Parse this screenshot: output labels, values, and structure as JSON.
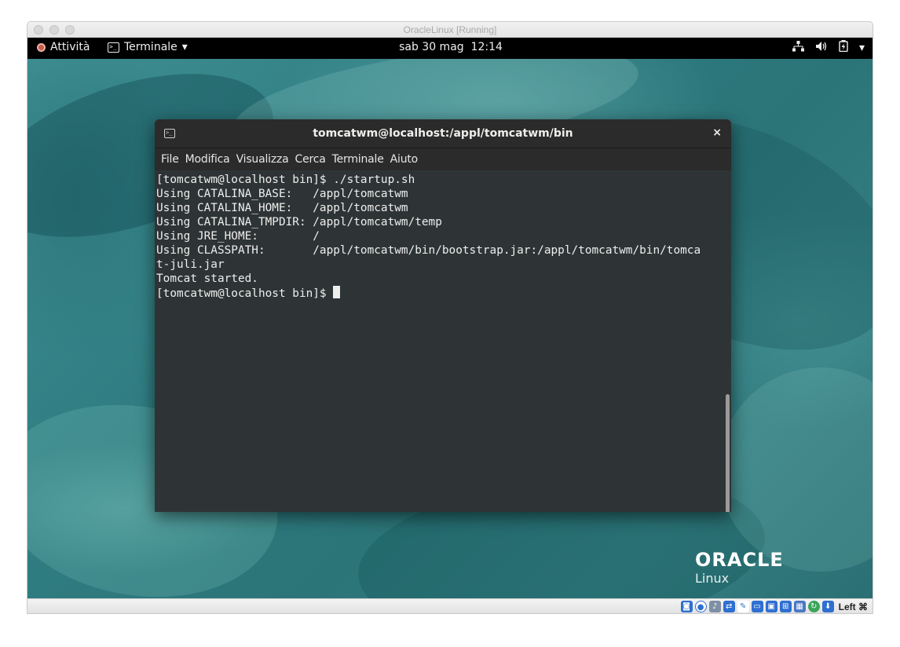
{
  "host_window": {
    "title": "OracleLinux [Running]"
  },
  "gnome_topbar": {
    "activities_label": "Attività",
    "app_menu_label": "Terminale",
    "app_menu_chevron": "▾",
    "clock": "sab 30 mag  12:14",
    "tray": {
      "network_icon": "network-wired-icon",
      "volume_icon": "volume-icon",
      "battery_icon": "battery-icon",
      "menu_chevron": "▾"
    }
  },
  "terminal": {
    "title": "tomcatwm@localhost:/appl/tomcatwm/bin",
    "close_glyph": "×",
    "menu": [
      "File",
      "Modifica",
      "Visualizza",
      "Cerca",
      "Terminale",
      "Aiuto"
    ],
    "lines": [
      "[tomcatwm@localhost bin]$ ./startup.sh",
      "Using CATALINA_BASE:   /appl/tomcatwm",
      "Using CATALINA_HOME:   /appl/tomcatwm",
      "Using CATALINA_TMPDIR: /appl/tomcatwm/temp",
      "Using JRE_HOME:        /",
      "Using CLASSPATH:       /appl/tomcatwm/bin/bootstrap.jar:/appl/tomcatwm/bin/tomca",
      "t-juli.jar",
      "Tomcat started."
    ],
    "prompt": "[tomcatwm@localhost bin]$ "
  },
  "wallpaper": {
    "brand": "ORACLE",
    "product": "Linux"
  },
  "statusbar": {
    "host_key": "Left ⌘",
    "icons": [
      "hard-disk-icon",
      "optical-drive-icon",
      "audio-icon",
      "network-icon",
      "usb-icon",
      "shared-folders-icon",
      "display-icon",
      "recording-icon",
      "cpu-icon",
      "mouse-integration-icon",
      "keyboard-icon"
    ]
  },
  "colors": {
    "terminal_bg": "#2e3436",
    "terminal_fg": "#eeeeec",
    "topbar_bg": "#000000",
    "wallpaper_teal": "#2f7d82"
  }
}
